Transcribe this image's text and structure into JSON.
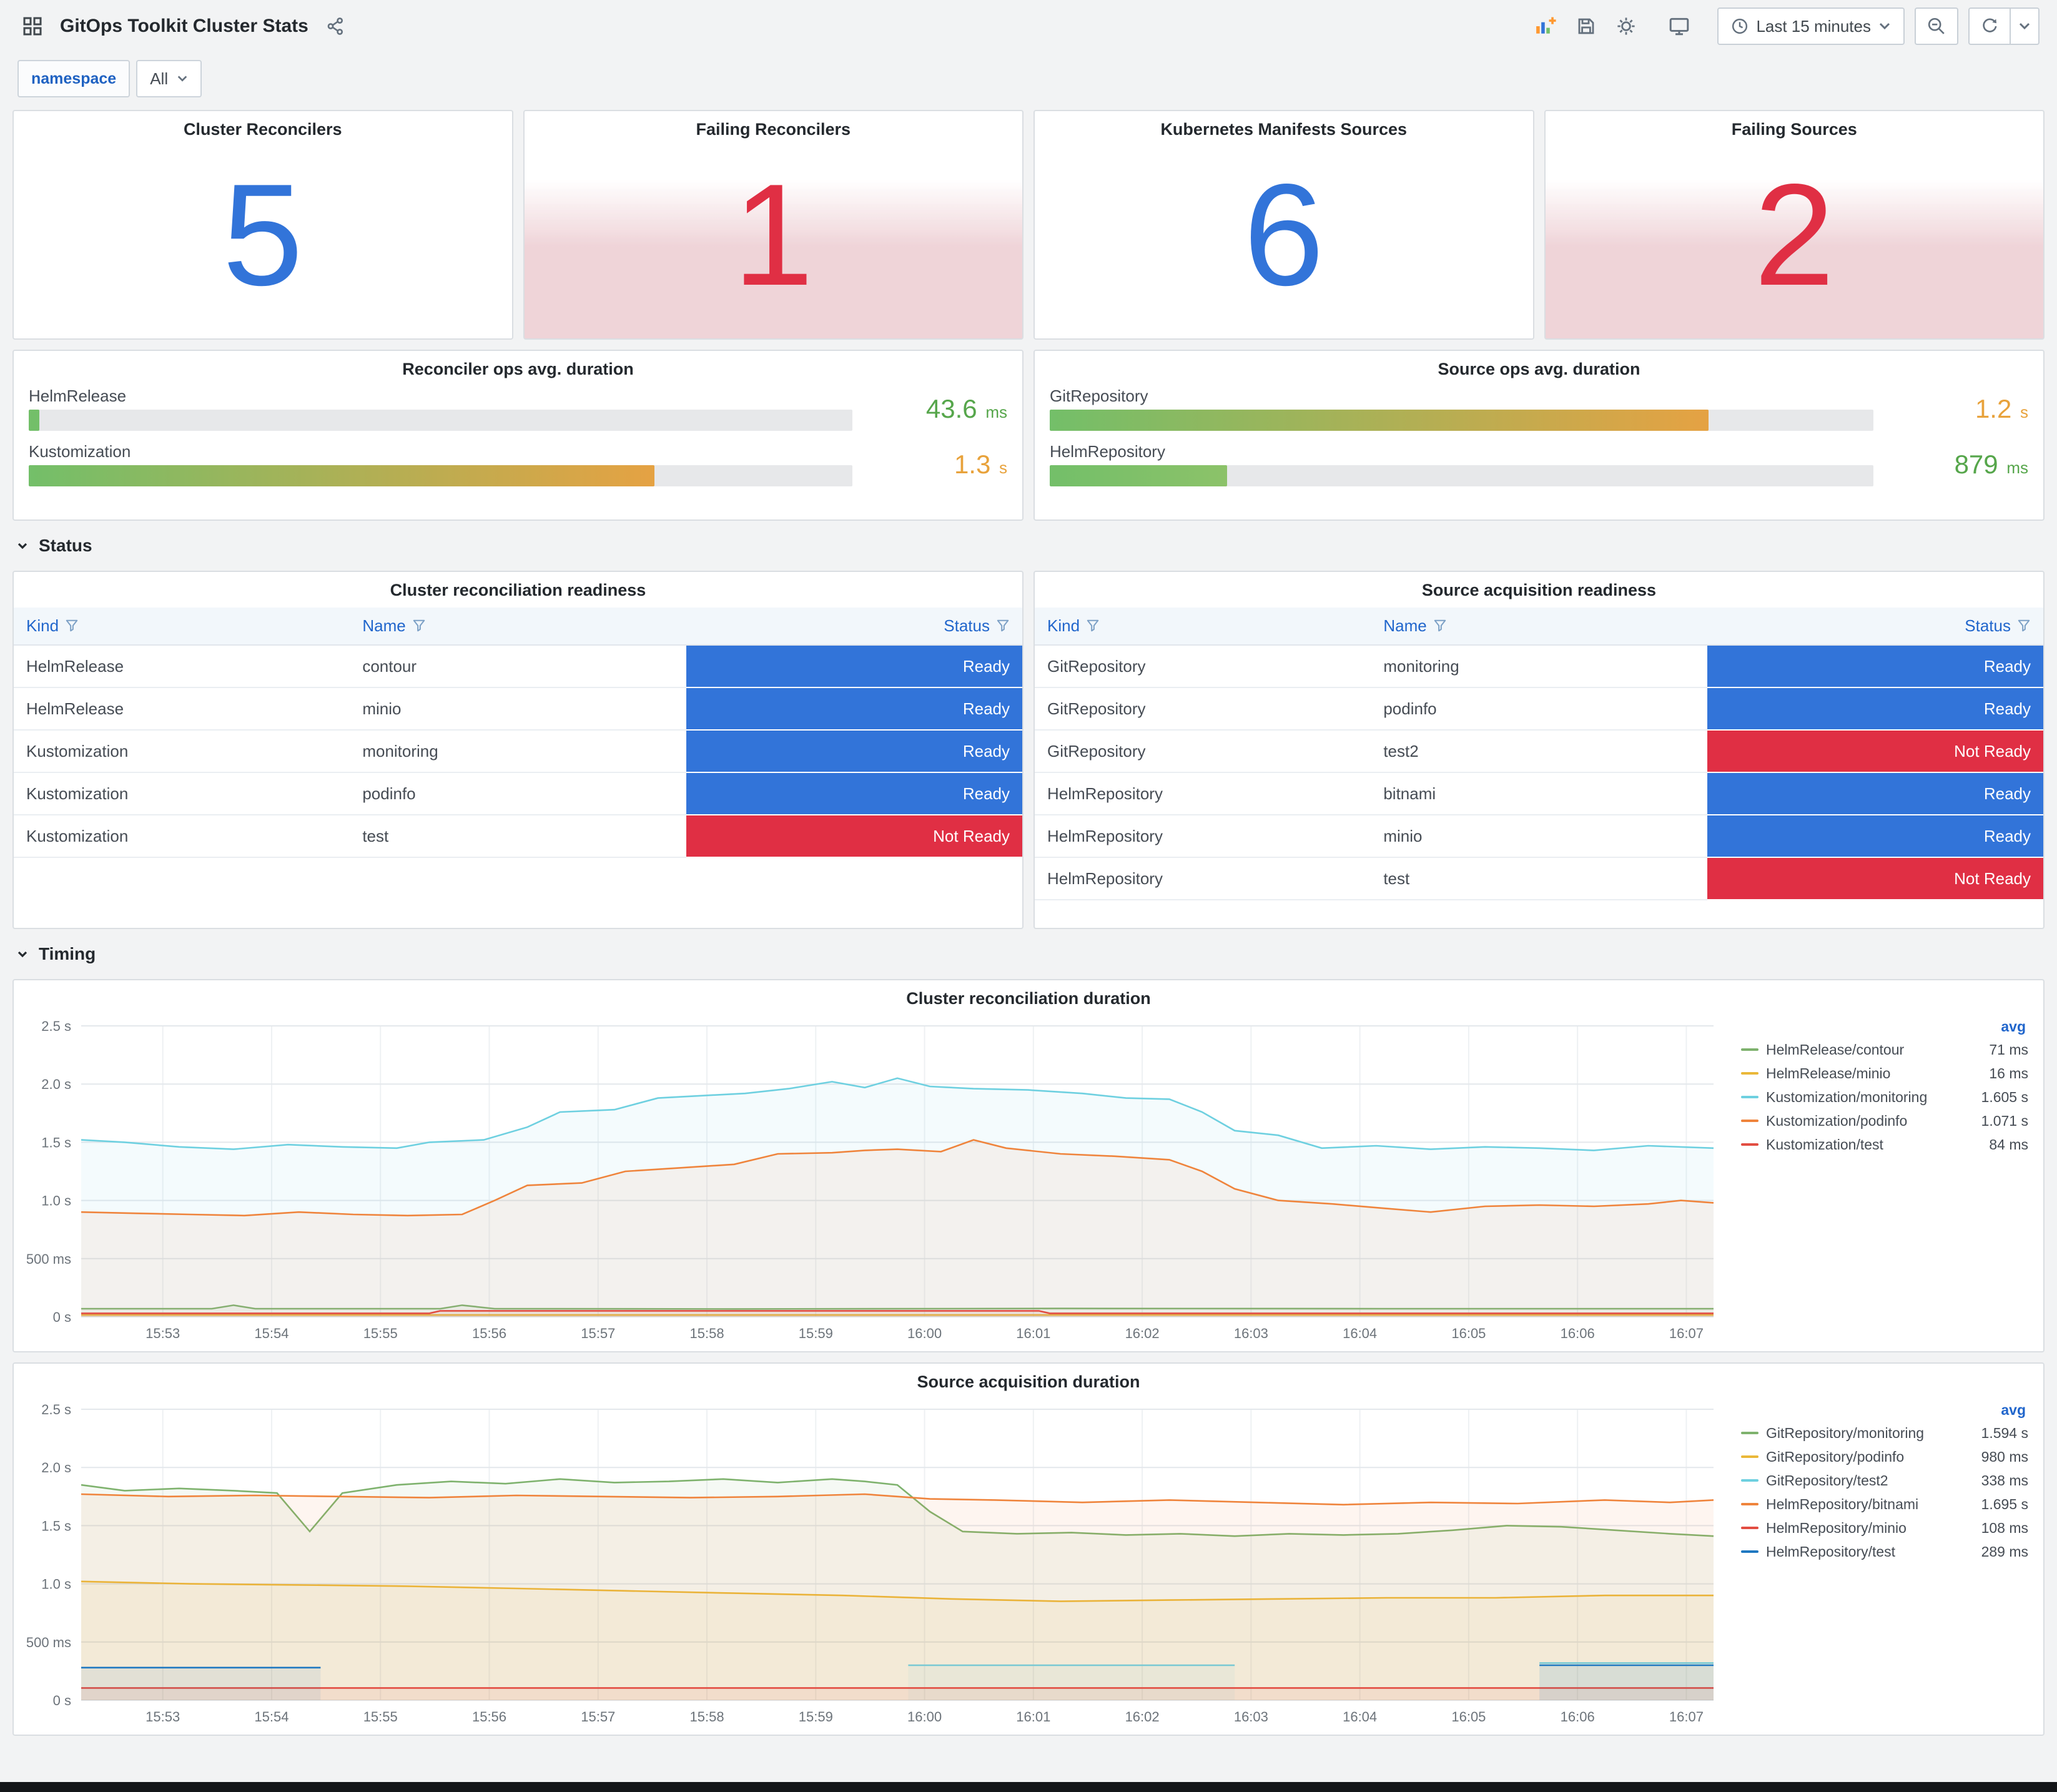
{
  "app": {
    "title": "GitOps Toolkit Cluster Stats",
    "time_range": "Last 15 minutes",
    "variable": {
      "label": "namespace",
      "value": "All"
    }
  },
  "stats": [
    {
      "title": "Cluster Reconcilers",
      "value": "5",
      "state": "ok"
    },
    {
      "title": "Failing Reconcilers",
      "value": "1",
      "state": "alert"
    },
    {
      "title": "Kubernetes Manifests Sources",
      "value": "6",
      "state": "ok"
    },
    {
      "title": "Failing Sources",
      "value": "2",
      "state": "alert"
    }
  ],
  "bar_gauges": [
    {
      "title": "Reconciler ops avg. duration",
      "rows": [
        {
          "label": "HelmRelease",
          "value": "43.6",
          "unit": "ms",
          "pct": 1.3,
          "tone": "green",
          "bar_colors": [
            "#73bf69",
            "#73bf69"
          ]
        },
        {
          "label": "Kustomization",
          "value": "1.3",
          "unit": "s",
          "pct": 76,
          "tone": "amber",
          "bar_colors": [
            "#73bf69",
            "#e5a243"
          ]
        }
      ]
    },
    {
      "title": "Source ops avg. duration",
      "rows": [
        {
          "label": "GitRepository",
          "value": "1.2",
          "unit": "s",
          "pct": 80,
          "tone": "amber",
          "bar_colors": [
            "#73bf69",
            "#e5a243"
          ]
        },
        {
          "label": "HelmRepository",
          "value": "879",
          "unit": "ms",
          "pct": 21.5,
          "tone": "green",
          "bar_colors": [
            "#73bf69",
            "#8cc269"
          ]
        }
      ]
    }
  ],
  "sections": [
    {
      "label": "Status"
    },
    {
      "label": "Timing"
    }
  ],
  "tables": [
    {
      "title": "Cluster reconciliation readiness",
      "columns": [
        "Kind",
        "Name",
        "Status"
      ],
      "rows": [
        [
          "HelmRelease",
          "contour",
          "Ready"
        ],
        [
          "HelmRelease",
          "minio",
          "Ready"
        ],
        [
          "Kustomization",
          "monitoring",
          "Ready"
        ],
        [
          "Kustomization",
          "podinfo",
          "Ready"
        ],
        [
          "Kustomization",
          "test",
          "Not Ready"
        ]
      ]
    },
    {
      "title": "Source acquisition readiness",
      "columns": [
        "Kind",
        "Name",
        "Status"
      ],
      "rows": [
        [
          "GitRepository",
          "monitoring",
          "Ready"
        ],
        [
          "GitRepository",
          "podinfo",
          "Ready"
        ],
        [
          "GitRepository",
          "test2",
          "Not Ready"
        ],
        [
          "HelmRepository",
          "bitnami",
          "Ready"
        ],
        [
          "HelmRepository",
          "minio",
          "Ready"
        ],
        [
          "HelmRepository",
          "test",
          "Not Ready"
        ]
      ]
    }
  ],
  "chart_data": [
    {
      "type": "line",
      "title": "Cluster reconciliation duration",
      "legend_header": "avg",
      "legend_position": "right",
      "grid": true,
      "ylim": [
        0,
        2.5
      ],
      "xlim": [
        0,
        15
      ],
      "y_ticks": [
        "0 s",
        "500 ms",
        "1.0 s",
        "1.5 s",
        "2.0 s",
        "2.5 s"
      ],
      "x_ticks": [
        "15:53",
        "15:54",
        "15:55",
        "15:56",
        "15:57",
        "15:58",
        "15:59",
        "16:00",
        "16:01",
        "16:02",
        "16:03",
        "16:04",
        "16:05",
        "16:06",
        "16:07"
      ],
      "series": [
        {
          "name": "HelmRelease/contour",
          "avg": "71 ms",
          "color": "#7eb26d",
          "points": [
            [
              0,
              0.07
            ],
            [
              1.2,
              0.07
            ],
            [
              1.4,
              0.1
            ],
            [
              1.6,
              0.07
            ],
            [
              3.3,
              0.07
            ],
            [
              3.5,
              0.1
            ],
            [
              3.8,
              0.07
            ],
            [
              6,
              0.068
            ],
            [
              9,
              0.072
            ],
            [
              12,
              0.07
            ],
            [
              15,
              0.07
            ]
          ]
        },
        {
          "name": "HelmRelease/minio",
          "avg": "16 ms",
          "color": "#eab839",
          "points": [
            [
              0,
              0.016
            ],
            [
              15,
              0.016
            ]
          ]
        },
        {
          "name": "Kustomization/monitoring",
          "avg": "1.605 s",
          "color": "#6ed0e0",
          "points": [
            [
              0,
              1.52
            ],
            [
              0.4,
              1.5
            ],
            [
              0.9,
              1.46
            ],
            [
              1.4,
              1.44
            ],
            [
              1.9,
              1.48
            ],
            [
              2.4,
              1.46
            ],
            [
              2.9,
              1.45
            ],
            [
              3.2,
              1.5
            ],
            [
              3.7,
              1.52
            ],
            [
              4.1,
              1.63
            ],
            [
              4.4,
              1.76
            ],
            [
              4.9,
              1.78
            ],
            [
              5.3,
              1.88
            ],
            [
              5.7,
              1.9
            ],
            [
              6.1,
              1.92
            ],
            [
              6.5,
              1.96
            ],
            [
              6.9,
              2.02
            ],
            [
              7.2,
              1.97
            ],
            [
              7.5,
              2.05
            ],
            [
              7.8,
              1.98
            ],
            [
              8.2,
              1.96
            ],
            [
              8.7,
              1.95
            ],
            [
              9.2,
              1.92
            ],
            [
              9.6,
              1.88
            ],
            [
              10,
              1.87
            ],
            [
              10.3,
              1.76
            ],
            [
              10.6,
              1.6
            ],
            [
              11,
              1.56
            ],
            [
              11.4,
              1.45
            ],
            [
              11.9,
              1.47
            ],
            [
              12.4,
              1.44
            ],
            [
              12.9,
              1.46
            ],
            [
              13.4,
              1.45
            ],
            [
              13.9,
              1.43
            ],
            [
              14.4,
              1.47
            ],
            [
              15,
              1.45
            ]
          ]
        },
        {
          "name": "Kustomization/podinfo",
          "avg": "1.071 s",
          "color": "#ef843c",
          "points": [
            [
              0,
              0.9
            ],
            [
              0.5,
              0.89
            ],
            [
              1,
              0.88
            ],
            [
              1.5,
              0.87
            ],
            [
              2,
              0.9
            ],
            [
              2.5,
              0.88
            ],
            [
              3,
              0.87
            ],
            [
              3.5,
              0.88
            ],
            [
              3.8,
              1.0
            ],
            [
              4.1,
              1.13
            ],
            [
              4.6,
              1.15
            ],
            [
              5,
              1.25
            ],
            [
              5.5,
              1.28
            ],
            [
              6,
              1.31
            ],
            [
              6.4,
              1.4
            ],
            [
              6.9,
              1.41
            ],
            [
              7.2,
              1.43
            ],
            [
              7.5,
              1.44
            ],
            [
              7.9,
              1.42
            ],
            [
              8.2,
              1.52
            ],
            [
              8.5,
              1.45
            ],
            [
              9,
              1.4
            ],
            [
              9.5,
              1.38
            ],
            [
              10,
              1.35
            ],
            [
              10.3,
              1.25
            ],
            [
              10.6,
              1.1
            ],
            [
              11,
              1.0
            ],
            [
              11.5,
              0.97
            ],
            [
              12,
              0.93
            ],
            [
              12.4,
              0.9
            ],
            [
              12.9,
              0.95
            ],
            [
              13.4,
              0.96
            ],
            [
              13.9,
              0.95
            ],
            [
              14.4,
              0.97
            ],
            [
              14.7,
              1.0
            ],
            [
              15,
              0.98
            ]
          ]
        },
        {
          "name": "Kustomization/test",
          "avg": "84 ms",
          "color": "#e24d42",
          "points": [
            [
              0,
              0.03
            ],
            [
              3.2,
              0.03
            ],
            [
              3.3,
              0.052
            ],
            [
              8.8,
              0.052
            ],
            [
              8.9,
              0.03
            ],
            [
              15,
              0.03
            ]
          ]
        }
      ]
    },
    {
      "type": "line",
      "title": "Source acquisition duration",
      "legend_header": "avg",
      "legend_position": "right",
      "grid": true,
      "ylim": [
        0,
        2.5
      ],
      "xlim": [
        0,
        15
      ],
      "y_ticks": [
        "0 s",
        "500 ms",
        "1.0 s",
        "1.5 s",
        "2.0 s",
        "2.5 s"
      ],
      "x_ticks": [
        "15:53",
        "15:54",
        "15:55",
        "15:56",
        "15:57",
        "15:58",
        "15:59",
        "16:00",
        "16:01",
        "16:02",
        "16:03",
        "16:04",
        "16:05",
        "16:06",
        "16:07"
      ],
      "series": [
        {
          "name": "GitRepository/monitoring",
          "avg": "1.594 s",
          "color": "#7eb26d",
          "points": [
            [
              0,
              1.85
            ],
            [
              0.4,
              1.8
            ],
            [
              0.9,
              1.82
            ],
            [
              1.4,
              1.8
            ],
            [
              1.8,
              1.78
            ],
            [
              2.1,
              1.45
            ],
            [
              2.4,
              1.78
            ],
            [
              2.9,
              1.85
            ],
            [
              3.4,
              1.88
            ],
            [
              3.9,
              1.86
            ],
            [
              4.4,
              1.9
            ],
            [
              4.9,
              1.87
            ],
            [
              5.4,
              1.88
            ],
            [
              5.9,
              1.9
            ],
            [
              6.4,
              1.87
            ],
            [
              6.9,
              1.9
            ],
            [
              7.2,
              1.88
            ],
            [
              7.5,
              1.85
            ],
            [
              7.8,
              1.62
            ],
            [
              8.1,
              1.45
            ],
            [
              8.6,
              1.43
            ],
            [
              9.1,
              1.44
            ],
            [
              9.6,
              1.42
            ],
            [
              10.1,
              1.43
            ],
            [
              10.6,
              1.41
            ],
            [
              11.1,
              1.43
            ],
            [
              11.6,
              1.42
            ],
            [
              12.1,
              1.43
            ],
            [
              12.6,
              1.46
            ],
            [
              13.1,
              1.5
            ],
            [
              13.6,
              1.49
            ],
            [
              14.1,
              1.46
            ],
            [
              14.6,
              1.43
            ],
            [
              15,
              1.41
            ]
          ]
        },
        {
          "name": "GitRepository/podinfo",
          "avg": "980 ms",
          "color": "#eab839",
          "points": [
            [
              0,
              1.02
            ],
            [
              1,
              1.0
            ],
            [
              2,
              0.99
            ],
            [
              3,
              0.98
            ],
            [
              4,
              0.96
            ],
            [
              5,
              0.94
            ],
            [
              6,
              0.92
            ],
            [
              7,
              0.9
            ],
            [
              8,
              0.87
            ],
            [
              9,
              0.85
            ],
            [
              10,
              0.86
            ],
            [
              11,
              0.87
            ],
            [
              12,
              0.88
            ],
            [
              13,
              0.88
            ],
            [
              14,
              0.9
            ],
            [
              15,
              0.9
            ]
          ]
        },
        {
          "name": "GitRepository/test2",
          "avg": "338 ms",
          "color": "#6ed0e0",
          "points": [
            [
              7.6,
              0.3
            ],
            [
              10.6,
              0.3
            ],
            null,
            [
              13.4,
              0.32
            ],
            [
              15,
              0.32
            ]
          ]
        },
        {
          "name": "HelmRepository/bitnami",
          "avg": "1.695 s",
          "color": "#ef843c",
          "points": [
            [
              0,
              1.77
            ],
            [
              0.8,
              1.75
            ],
            [
              1.6,
              1.76
            ],
            [
              2.4,
              1.75
            ],
            [
              3.2,
              1.74
            ],
            [
              4,
              1.76
            ],
            [
              4.8,
              1.75
            ],
            [
              5.6,
              1.74
            ],
            [
              6.4,
              1.75
            ],
            [
              7.2,
              1.77
            ],
            [
              7.8,
              1.73
            ],
            [
              8.4,
              1.72
            ],
            [
              9.2,
              1.7
            ],
            [
              10,
              1.72
            ],
            [
              10.8,
              1.7
            ],
            [
              11.6,
              1.68
            ],
            [
              12.4,
              1.7
            ],
            [
              13.2,
              1.69
            ],
            [
              14,
              1.72
            ],
            [
              14.6,
              1.7
            ],
            [
              15,
              1.72
            ]
          ]
        },
        {
          "name": "HelmRepository/minio",
          "avg": "108 ms",
          "color": "#e24d42",
          "points": [
            [
              0,
              0.105
            ],
            [
              15,
              0.105
            ]
          ]
        },
        {
          "name": "HelmRepository/test",
          "avg": "289 ms",
          "color": "#1f78c1",
          "points": [
            [
              0,
              0.28
            ],
            [
              2.2,
              0.28
            ],
            null,
            [
              13.4,
              0.3
            ],
            [
              15,
              0.3
            ]
          ]
        }
      ]
    }
  ],
  "colors": {
    "green": "#56a64b",
    "amber": "#e8a23b",
    "ready": "#3274d9",
    "not_ready": "#e02f44",
    "stat_ok": "#3274d9",
    "stat_alert": "#e02f44"
  }
}
